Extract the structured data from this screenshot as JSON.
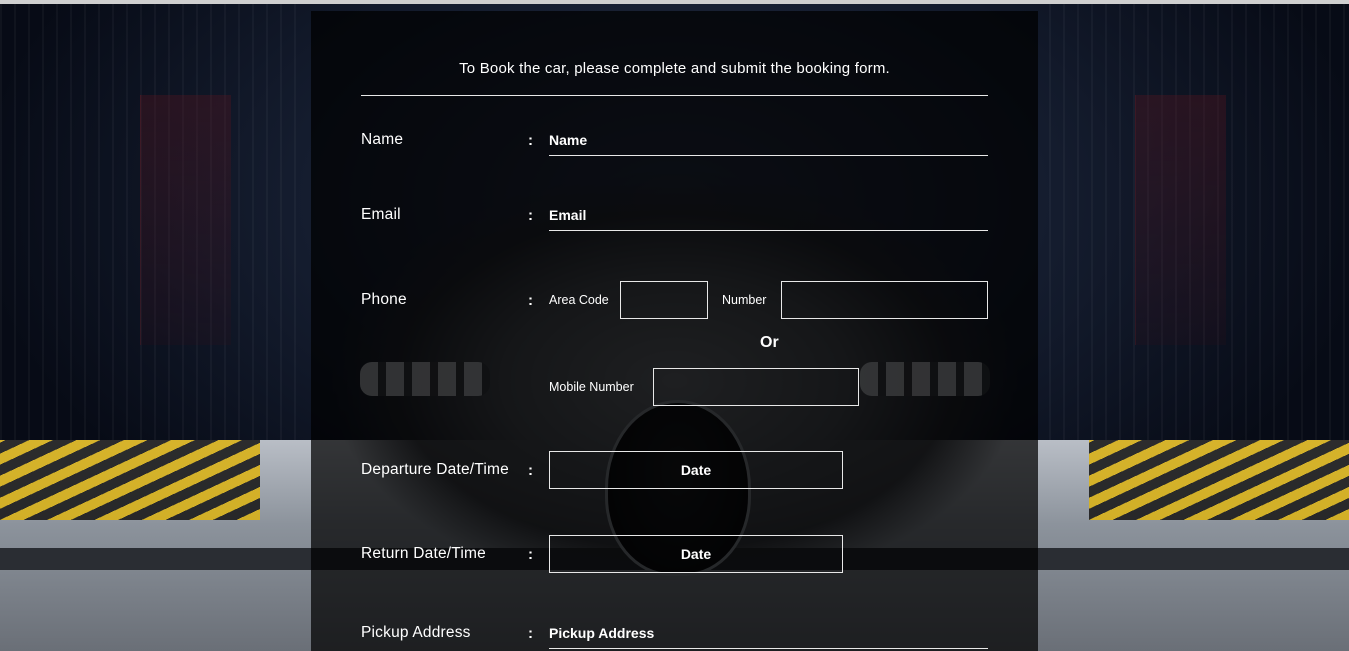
{
  "form": {
    "intro": "To Book the car, please complete and submit the booking form.",
    "colon": ":",
    "name": {
      "label": "Name",
      "placeholder": "Name"
    },
    "email": {
      "label": "Email",
      "placeholder": "Email"
    },
    "phone": {
      "label": "Phone",
      "area_code_label": "Area Code",
      "number_label": "Number",
      "or_label": "Or",
      "mobile_label": "Mobile Number"
    },
    "departure": {
      "label": "Departure Date/Time",
      "button": "Date"
    },
    "return": {
      "label": "Return Date/Time",
      "button": "Date"
    },
    "pickup": {
      "label": "Pickup Address",
      "placeholder": "Pickup Address"
    }
  },
  "colors": {
    "panel_overlay": "#000000",
    "text": "#ffffff",
    "border": "#e8e8e8"
  }
}
